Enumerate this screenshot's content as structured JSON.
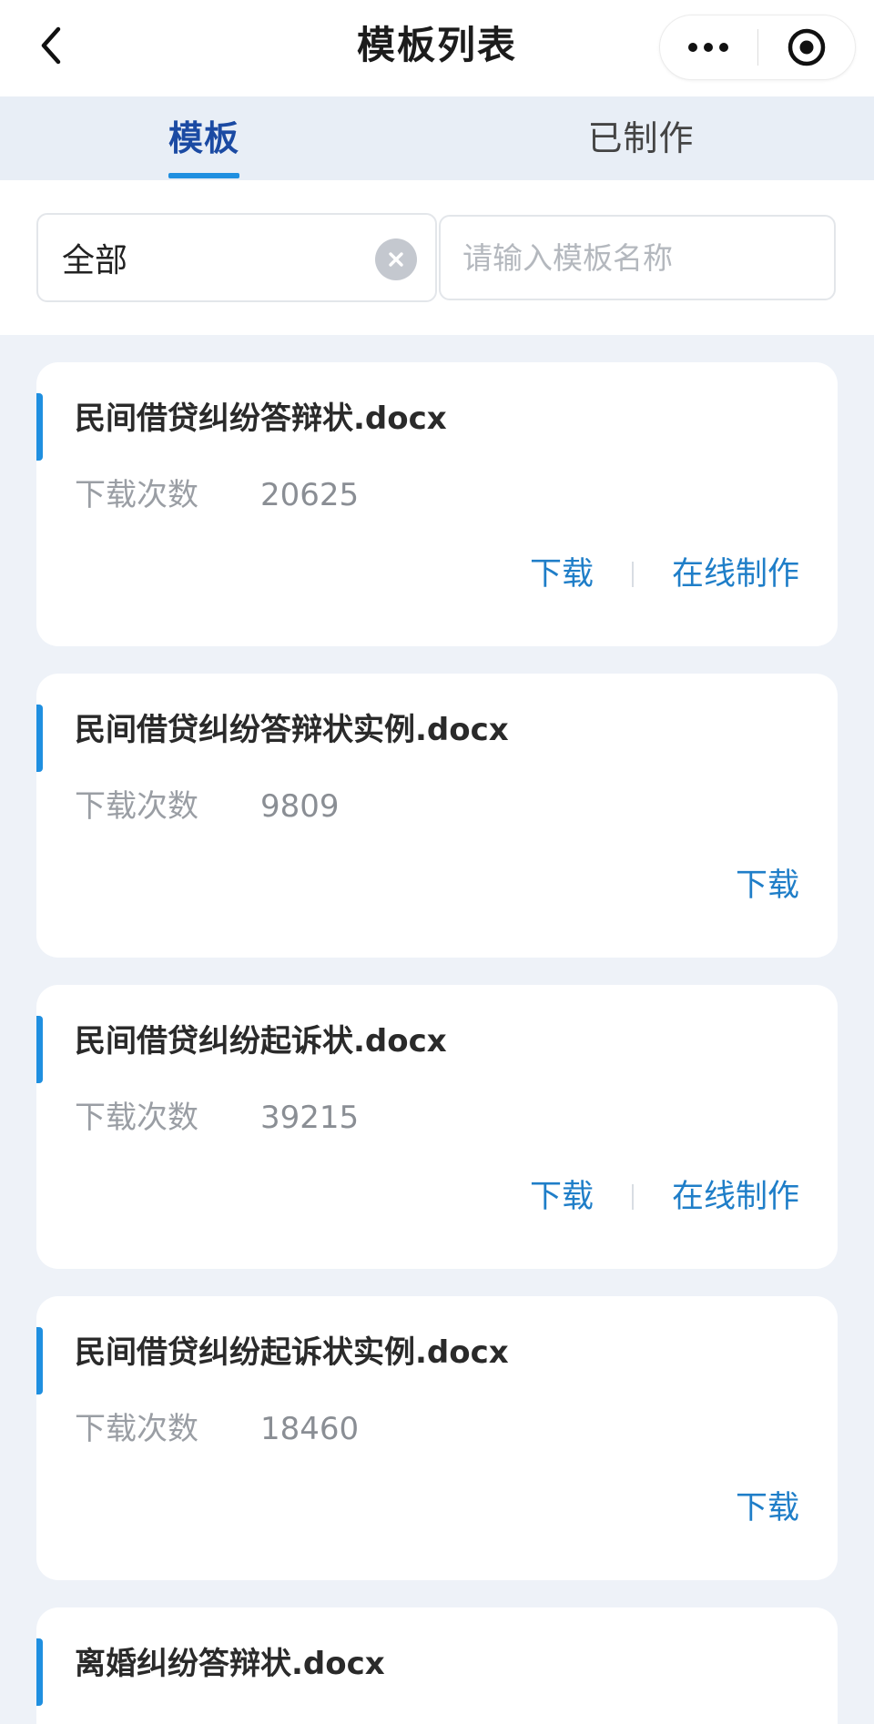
{
  "header": {
    "title": "模板列表",
    "back_icon": "chevron-left-icon",
    "more_icon": "more-dots-icon",
    "close_icon": "target-circle-icon"
  },
  "tabs": [
    {
      "label": "模板",
      "active": true
    },
    {
      "label": "已制作",
      "active": false
    }
  ],
  "filter": {
    "category_value": "全部",
    "clear_icon": "clear-circle-icon",
    "search_placeholder": "请输入模板名称",
    "search_value": ""
  },
  "list": {
    "stat_label": "下载次数",
    "download_label": "下载",
    "online_label": "在线制作",
    "items": [
      {
        "title": "民间借贷纠纷答辩状.docx",
        "downloads": "20625",
        "online": true
      },
      {
        "title": "民间借贷纠纷答辩状实例.docx",
        "downloads": "9809",
        "online": false
      },
      {
        "title": "民间借贷纠纷起诉状.docx",
        "downloads": "39215",
        "online": true
      },
      {
        "title": "民间借贷纠纷起诉状实例.docx",
        "downloads": "18460",
        "online": false
      },
      {
        "title": "离婚纠纷答辩状.docx",
        "downloads": "",
        "online": false
      }
    ]
  },
  "colors": {
    "accent": "#1f8fe0",
    "link": "#1f7ec8",
    "active_tab": "#1b4aa3",
    "background": "#eef2f8"
  }
}
